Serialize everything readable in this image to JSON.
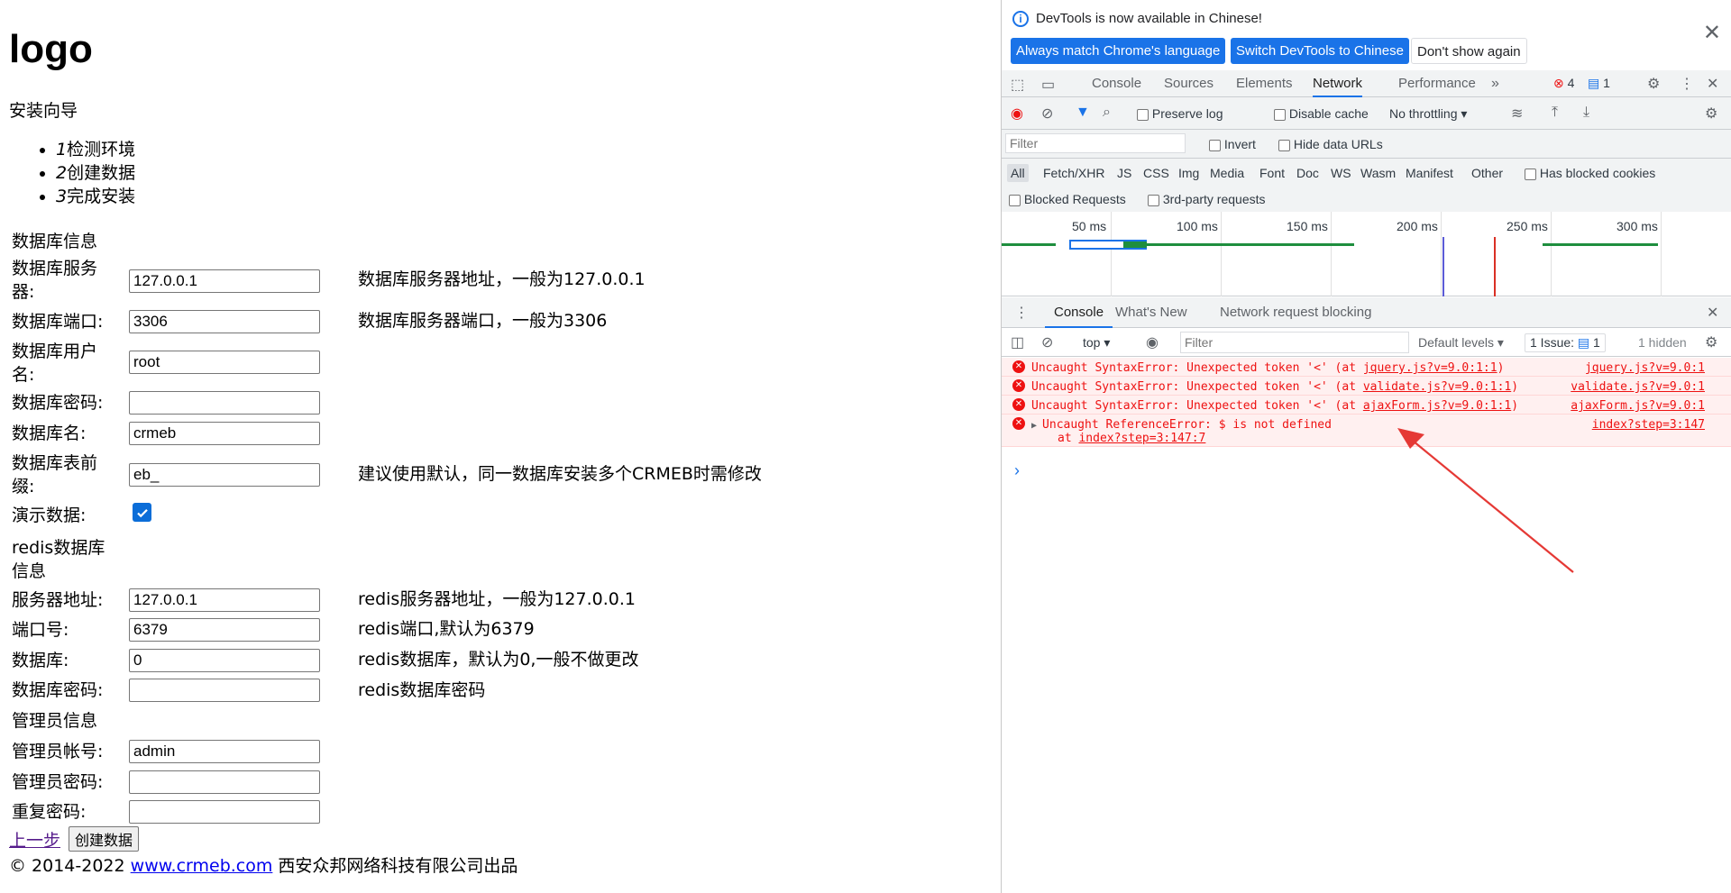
{
  "page": {
    "logo": "logo",
    "wizard_title": "安装向导",
    "steps": [
      {
        "num": "1",
        "text": "检测环境"
      },
      {
        "num": "2",
        "text": "创建数据"
      },
      {
        "num": "3",
        "text": "完成安装"
      }
    ],
    "db_section": "数据库信息",
    "db_host_label": "数据库服务器:",
    "db_host_value": "127.0.0.1",
    "db_host_hint": "数据库服务器地址，一般为127.0.0.1",
    "db_port_label": "数据库端口:",
    "db_port_value": "3306",
    "db_port_hint": "数据库服务器端口，一般为3306",
    "db_user_label": "数据库用户名:",
    "db_user_value": "root",
    "db_pass_label": "数据库密码:",
    "db_name_label": "数据库名:",
    "db_name_value": "crmeb",
    "db_prefix_label": "数据库表前缀:",
    "db_prefix_value": "eb_",
    "db_prefix_hint": "建议使用默认，同一数据库安装多个CRMEB时需修改",
    "demo_label": "演示数据:",
    "redis_section": "redis数据库信息",
    "redis_host_label": "服务器地址:",
    "redis_host_value": "127.0.0.1",
    "redis_host_hint": "redis服务器地址，一般为127.0.0.1",
    "redis_port_label": "端口号:",
    "redis_port_value": "6379",
    "redis_port_hint": "redis端口,默认为6379",
    "redis_db_label": "数据库:",
    "redis_db_value": "0",
    "redis_db_hint": "redis数据库，默认为0,一般不做更改",
    "redis_pass_label": "数据库密码:",
    "redis_pass_hint": "redis数据库密码",
    "admin_section": "管理员信息",
    "admin_user_label": "管理员帐号:",
    "admin_user_value": "admin",
    "admin_pass_label": "管理员密码:",
    "admin_repass_label": "重复密码:",
    "prev_link": "上一步",
    "create_button": "创建数据",
    "footer_prefix": "© 2014-2022 ",
    "footer_link": "www.crmeb.com",
    "footer_suffix": " 西安众邦网络科技有限公司出品"
  },
  "devtools": {
    "banner_msg": "DevTools is now available in Chinese!",
    "btn_match": "Always match Chrome's language",
    "btn_switch": "Switch DevTools to Chinese",
    "btn_dont": "Don't show again",
    "tabs": [
      "Console",
      "Sources",
      "Elements",
      "Network",
      "Performance"
    ],
    "error_count": "4",
    "issue_count": "1",
    "preserve_log": "Preserve log",
    "disable_cache": "Disable cache",
    "throttling": "No throttling",
    "filter_placeholder": "Filter",
    "invert": "Invert",
    "hide_data_urls": "Hide data URLs",
    "types": [
      "All",
      "Fetch/XHR",
      "JS",
      "CSS",
      "Img",
      "Media",
      "Font",
      "Doc",
      "WS",
      "Wasm",
      "Manifest",
      "Other"
    ],
    "has_blocked_cookies": "Has blocked cookies",
    "blocked_requests": "Blocked Requests",
    "third_party": "3rd-party requests",
    "timeline_ticks": [
      "50 ms",
      "100 ms",
      "150 ms",
      "200 ms",
      "250 ms",
      "300 ms"
    ],
    "drawer_tabs": [
      "Console",
      "What's New",
      "Network request blocking"
    ],
    "context": "top",
    "console_filter": "Filter",
    "levels": "Default levels",
    "issues": "1 Issue:",
    "issues_count": "1",
    "hidden": "1 hidden",
    "errors": [
      {
        "pre": "Uncaught SyntaxError: Unexpected token '<' (at ",
        "link": "jquery.js?v=9.0:1:1",
        "post": ")",
        "src": "jquery.js?v=9.0:1"
      },
      {
        "pre": "Uncaught SyntaxError: Unexpected token '<' (at ",
        "link": "validate.js?v=9.0:1:1",
        "post": ")",
        "src": "validate.js?v=9.0:1"
      },
      {
        "pre": "Uncaught SyntaxError: Unexpected token '<' (at ",
        "link": "ajaxForm.js?v=9.0:1:1",
        "post": ")",
        "src": "ajaxForm.js?v=9.0:1"
      },
      {
        "pre": "Uncaught ReferenceError: $ is not defined",
        "at": "at ",
        "link": "index?step=3:147:7",
        "src": "index?step=3:147"
      }
    ],
    "prompt": "›"
  }
}
